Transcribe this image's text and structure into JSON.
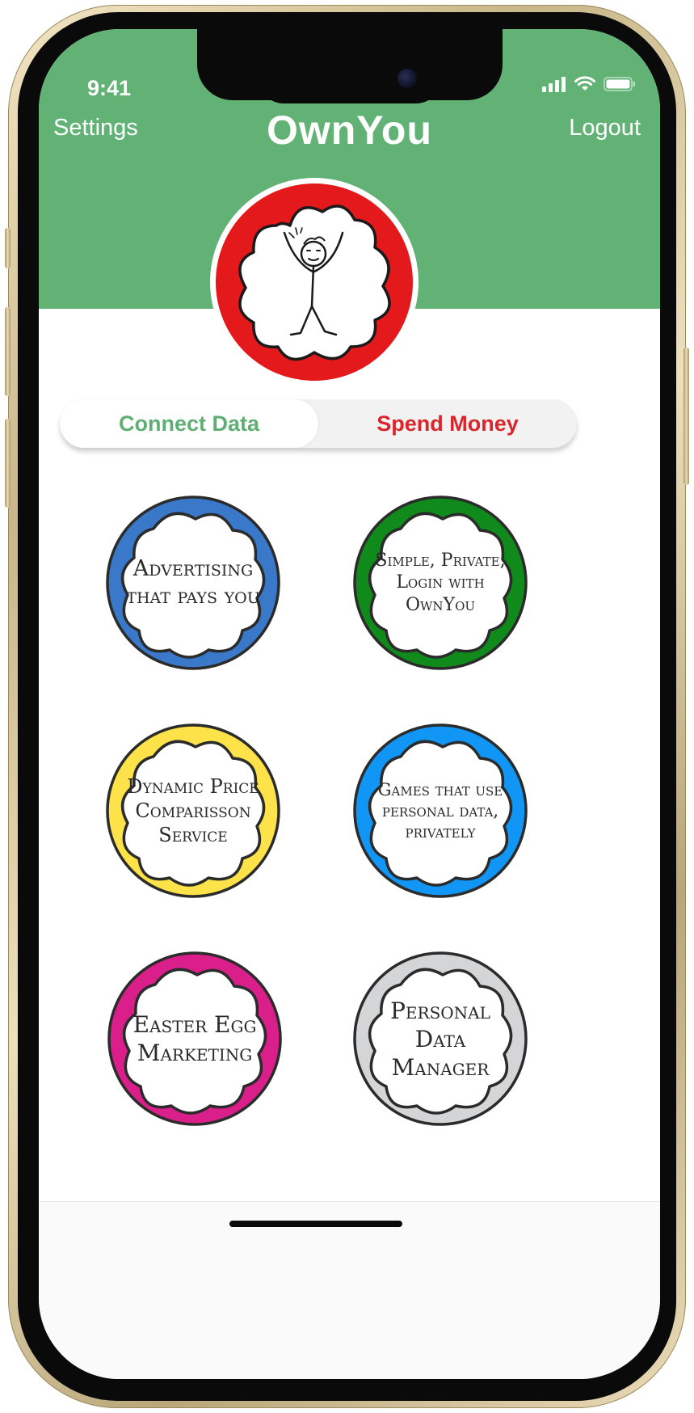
{
  "status_bar": {
    "time": "9:41"
  },
  "header": {
    "title": "OwnYou",
    "settings_label": "Settings",
    "logout_label": "Logout"
  },
  "tabs": {
    "connect_label": "Connect Data",
    "spend_label": "Spend Money",
    "active": "connect"
  },
  "features": [
    {
      "lines": [
        "Advertising",
        "that pays you"
      ],
      "color": "#3a78c9"
    },
    {
      "lines": [
        "Simple, Private,",
        "Login with",
        "OwnYou"
      ],
      "color": "#108a1a"
    },
    {
      "lines": [
        "Dynamic Price",
        "Comparisson",
        "Service"
      ],
      "color": "#fde24a"
    },
    {
      "lines": [
        "Games that use",
        "personal data,",
        "privately"
      ],
      "color": "#1196f5"
    },
    {
      "lines": [
        "Easter Egg",
        "Marketing"
      ],
      "color": "#db1f8a"
    },
    {
      "lines": [
        "Personal",
        "Data",
        "Manager"
      ],
      "color": "#d4d5d6"
    }
  ],
  "colors": {
    "header_green": "#62b276",
    "avatar_red": "#e3191b",
    "connect_green": "#5fae73",
    "spend_red": "#d8262c"
  },
  "icons": {
    "signal": "signal-icon",
    "wifi": "wifi-icon",
    "battery": "battery-icon",
    "avatar": "stick-figure-icon"
  }
}
